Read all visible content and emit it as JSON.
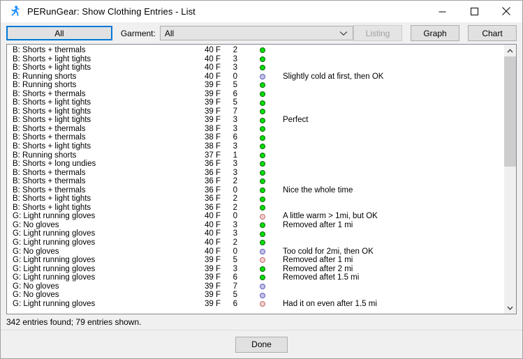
{
  "window": {
    "title": "PERunGear: Show Clothing Entries - List",
    "icon": "running-person-icon",
    "controls": {
      "minimize": "minimize-icon",
      "maximize": "maximize-icon",
      "close": "close-icon"
    }
  },
  "toolbar": {
    "all_button": "All",
    "garment_label": "Garment:",
    "garment_value": "All",
    "garment_options": [
      "All"
    ],
    "listing_button": "Listing",
    "listing_disabled": true,
    "graph_button": "Graph",
    "chart_button": "Chart"
  },
  "colors": {
    "accent": "#0078d7",
    "green_dot": "#00e000",
    "blue_dot": "#c3c3e8",
    "pink_dot": "#f5cfcf",
    "window_bg": "#f0f0f0",
    "list_bg": "#ffffff"
  },
  "list": {
    "rows": [
      {
        "garment": "B: Shorts + thermals",
        "temp": "40 F",
        "num": "2",
        "dot": "green",
        "note": ""
      },
      {
        "garment": "B: Shorts + light tights",
        "temp": "40 F",
        "num": "3",
        "dot": "green",
        "note": ""
      },
      {
        "garment": "B: Shorts + light tights",
        "temp": "40 F",
        "num": "3",
        "dot": "green",
        "note": ""
      },
      {
        "garment": "B: Running shorts",
        "temp": "40 F",
        "num": "0",
        "dot": "blue",
        "note": "Slightly cold at first, then OK"
      },
      {
        "garment": "B: Running shorts",
        "temp": "39 F",
        "num": "5",
        "dot": "green",
        "note": ""
      },
      {
        "garment": "B: Shorts + thermals",
        "temp": "39 F",
        "num": "6",
        "dot": "green",
        "note": ""
      },
      {
        "garment": "B: Shorts + light tights",
        "temp": "39 F",
        "num": "5",
        "dot": "green",
        "note": ""
      },
      {
        "garment": "B: Shorts + light tights",
        "temp": "39 F",
        "num": "7",
        "dot": "green",
        "note": ""
      },
      {
        "garment": "B: Shorts + light tights",
        "temp": "39 F",
        "num": "3",
        "dot": "green",
        "note": "Perfect"
      },
      {
        "garment": "B: Shorts + thermals",
        "temp": "38 F",
        "num": "3",
        "dot": "green",
        "note": ""
      },
      {
        "garment": "B: Shorts + thermals",
        "temp": "38 F",
        "num": "6",
        "dot": "green",
        "note": ""
      },
      {
        "garment": "B: Shorts + light tights",
        "temp": "38 F",
        "num": "3",
        "dot": "green",
        "note": ""
      },
      {
        "garment": "B: Running shorts",
        "temp": "37 F",
        "num": "1",
        "dot": "green",
        "note": ""
      },
      {
        "garment": "B: Shorts + long undies",
        "temp": "36 F",
        "num": "3",
        "dot": "green",
        "note": ""
      },
      {
        "garment": "B: Shorts + thermals",
        "temp": "36 F",
        "num": "3",
        "dot": "green",
        "note": ""
      },
      {
        "garment": "B: Shorts + thermals",
        "temp": "36 F",
        "num": "2",
        "dot": "green",
        "note": ""
      },
      {
        "garment": "B: Shorts + thermals",
        "temp": "36 F",
        "num": "0",
        "dot": "green",
        "note": "Nice the whole time"
      },
      {
        "garment": "B: Shorts + light tights",
        "temp": "36 F",
        "num": "2",
        "dot": "green",
        "note": ""
      },
      {
        "garment": "B: Shorts + light tights",
        "temp": "36 F",
        "num": "2",
        "dot": "green",
        "note": ""
      },
      {
        "garment": "G: Light running gloves",
        "temp": "40 F",
        "num": "0",
        "dot": "pink",
        "note": "A little warm > 1mi, but OK"
      },
      {
        "garment": "G: No gloves",
        "temp": "40 F",
        "num": "3",
        "dot": "green",
        "note": "Removed after 1 mi"
      },
      {
        "garment": "G: Light running gloves",
        "temp": "40 F",
        "num": "3",
        "dot": "green",
        "note": ""
      },
      {
        "garment": "G: Light running gloves",
        "temp": "40 F",
        "num": "2",
        "dot": "green",
        "note": ""
      },
      {
        "garment": "G: No gloves",
        "temp": "40 F",
        "num": "0",
        "dot": "blue",
        "note": "Too cold for 2mi, then OK"
      },
      {
        "garment": "G: Light running gloves",
        "temp": "39 F",
        "num": "5",
        "dot": "pink",
        "note": "Removed after 1 mi"
      },
      {
        "garment": "G: Light running gloves",
        "temp": "39 F",
        "num": "3",
        "dot": "green",
        "note": "Removed after 2 mi"
      },
      {
        "garment": "G: Light running gloves",
        "temp": "39 F",
        "num": "6",
        "dot": "green",
        "note": "Removed aftet 1.5 mi"
      },
      {
        "garment": "G: No gloves",
        "temp": "39 F",
        "num": "7",
        "dot": "blue",
        "note": ""
      },
      {
        "garment": "G: No gloves",
        "temp": "39 F",
        "num": "5",
        "dot": "blue",
        "note": ""
      },
      {
        "garment": "G: Light running gloves",
        "temp": "39 F",
        "num": "6",
        "dot": "pink",
        "note": "Had it on even after 1.5 mi"
      }
    ]
  },
  "scrollbar": {
    "up_arrow": "chevron-up-icon",
    "down_arrow": "chevron-down-icon",
    "thumb_percent": 45
  },
  "status": {
    "text": "342 entries found; 79 entries shown."
  },
  "footer": {
    "done_button": "Done"
  }
}
